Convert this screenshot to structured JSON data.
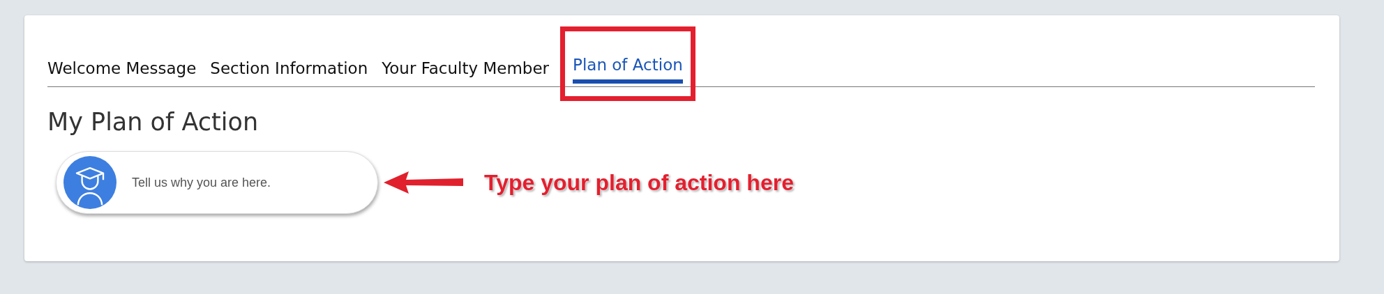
{
  "tabs": [
    {
      "label": "Welcome Message",
      "selected": false
    },
    {
      "label": "Section Information",
      "selected": false
    },
    {
      "label": "Your Faculty Member",
      "selected": false
    },
    {
      "label": "Plan of Action",
      "selected": true
    }
  ],
  "heading": "My Plan of Action",
  "plan_field": {
    "placeholder": "Tell us why you are here."
  },
  "annotation": {
    "text": "Type your plan of action here"
  }
}
